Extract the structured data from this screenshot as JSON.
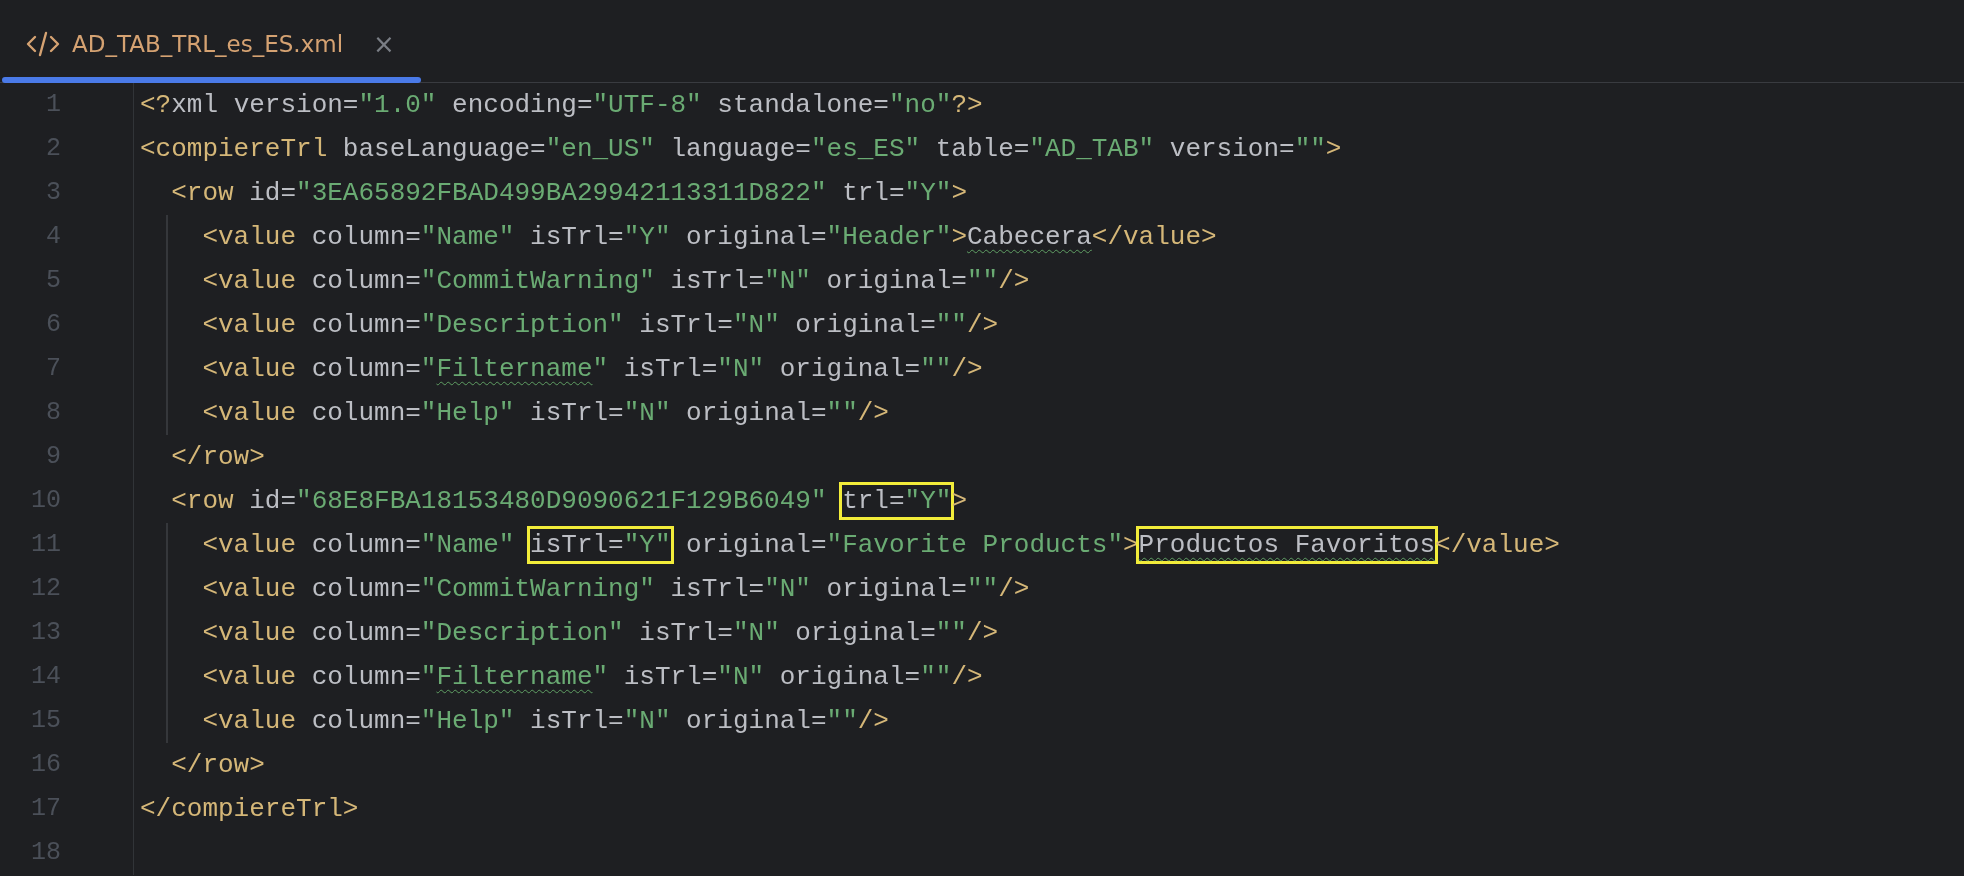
{
  "tabs": [
    {
      "label": "AD_TAB_TRL_es_ES.xml",
      "selected": true,
      "close": "×"
    }
  ],
  "editor": {
    "lines": [
      {
        "number": "1",
        "guide": false,
        "spans": [
          {
            "boxed": false,
            "tokens": [
              {
                "text": "<?",
                "kind": "tag",
                "wavy": false
              },
              {
                "text": "xml version=",
                "kind": "attr",
                "wavy": false
              },
              {
                "text": "\"1.0\"",
                "kind": "value",
                "wavy": false
              },
              {
                "text": " encoding=",
                "kind": "attr",
                "wavy": false
              },
              {
                "text": "\"UTF-8\"",
                "kind": "value",
                "wavy": false
              },
              {
                "text": " standalone=",
                "kind": "attr",
                "wavy": false
              },
              {
                "text": "\"no\"",
                "kind": "value",
                "wavy": false
              },
              {
                "text": "?>",
                "kind": "tag",
                "wavy": false
              }
            ]
          }
        ]
      },
      {
        "number": "2",
        "guide": false,
        "spans": [
          {
            "boxed": false,
            "tokens": [
              {
                "text": "<compiereTrl",
                "kind": "tag",
                "wavy": false
              },
              {
                "text": " baseLanguage=",
                "kind": "attr",
                "wavy": false
              },
              {
                "text": "\"en_US\"",
                "kind": "value",
                "wavy": false
              },
              {
                "text": " language=",
                "kind": "attr",
                "wavy": false
              },
              {
                "text": "\"es_ES\"",
                "kind": "value",
                "wavy": false
              },
              {
                "text": " table=",
                "kind": "attr",
                "wavy": false
              },
              {
                "text": "\"AD_TAB\"",
                "kind": "value",
                "wavy": false
              },
              {
                "text": " version=",
                "kind": "attr",
                "wavy": false
              },
              {
                "text": "\"\"",
                "kind": "value",
                "wavy": false
              },
              {
                "text": ">",
                "kind": "tag",
                "wavy": false
              }
            ]
          }
        ]
      },
      {
        "number": "3",
        "guide": false,
        "spans": [
          {
            "boxed": false,
            "tokens": [
              {
                "text": "  <row",
                "kind": "tag",
                "wavy": false
              },
              {
                "text": " id=",
                "kind": "attr",
                "wavy": false
              },
              {
                "text": "\"3EA65892FBAD499BA29942113311D822\"",
                "kind": "value",
                "wavy": false
              },
              {
                "text": " trl=",
                "kind": "attr",
                "wavy": false
              },
              {
                "text": "\"Y\"",
                "kind": "value",
                "wavy": false
              },
              {
                "text": ">",
                "kind": "tag",
                "wavy": false
              }
            ]
          }
        ]
      },
      {
        "number": "4",
        "guide": true,
        "spans": [
          {
            "boxed": false,
            "tokens": [
              {
                "text": "    <value",
                "kind": "tag",
                "wavy": false
              },
              {
                "text": " column=",
                "kind": "attr",
                "wavy": false
              },
              {
                "text": "\"Name\"",
                "kind": "value",
                "wavy": false
              },
              {
                "text": " isTrl=",
                "kind": "attr",
                "wavy": false
              },
              {
                "text": "\"Y\"",
                "kind": "value",
                "wavy": false
              },
              {
                "text": " original=",
                "kind": "attr",
                "wavy": false
              },
              {
                "text": "\"Header\"",
                "kind": "value",
                "wavy": false
              },
              {
                "text": ">",
                "kind": "tag",
                "wavy": false
              },
              {
                "text": "Cabecera",
                "kind": "text",
                "wavy": true
              },
              {
                "text": "</value>",
                "kind": "tag",
                "wavy": false
              }
            ]
          }
        ]
      },
      {
        "number": "5",
        "guide": true,
        "spans": [
          {
            "boxed": false,
            "tokens": [
              {
                "text": "    <value",
                "kind": "tag",
                "wavy": false
              },
              {
                "text": " column=",
                "kind": "attr",
                "wavy": false
              },
              {
                "text": "\"CommitWarning\"",
                "kind": "value",
                "wavy": false
              },
              {
                "text": " isTrl=",
                "kind": "attr",
                "wavy": false
              },
              {
                "text": "\"N\"",
                "kind": "value",
                "wavy": false
              },
              {
                "text": " original=",
                "kind": "attr",
                "wavy": false
              },
              {
                "text": "\"\"",
                "kind": "value",
                "wavy": false
              },
              {
                "text": "/>",
                "kind": "tag",
                "wavy": false
              }
            ]
          }
        ]
      },
      {
        "number": "6",
        "guide": true,
        "spans": [
          {
            "boxed": false,
            "tokens": [
              {
                "text": "    <value",
                "kind": "tag",
                "wavy": false
              },
              {
                "text": " column=",
                "kind": "attr",
                "wavy": false
              },
              {
                "text": "\"Description\"",
                "kind": "value",
                "wavy": false
              },
              {
                "text": " isTrl=",
                "kind": "attr",
                "wavy": false
              },
              {
                "text": "\"N\"",
                "kind": "value",
                "wavy": false
              },
              {
                "text": " original=",
                "kind": "attr",
                "wavy": false
              },
              {
                "text": "\"\"",
                "kind": "value",
                "wavy": false
              },
              {
                "text": "/>",
                "kind": "tag",
                "wavy": false
              }
            ]
          }
        ]
      },
      {
        "number": "7",
        "guide": true,
        "spans": [
          {
            "boxed": false,
            "tokens": [
              {
                "text": "    <value",
                "kind": "tag",
                "wavy": false
              },
              {
                "text": " column=",
                "kind": "attr",
                "wavy": false
              },
              {
                "text": "\"",
                "kind": "value",
                "wavy": false
              },
              {
                "text": "Filtername",
                "kind": "value",
                "wavy": true
              },
              {
                "text": "\"",
                "kind": "value",
                "wavy": false
              },
              {
                "text": " isTrl=",
                "kind": "attr",
                "wavy": false
              },
              {
                "text": "\"N\"",
                "kind": "value",
                "wavy": false
              },
              {
                "text": " original=",
                "kind": "attr",
                "wavy": false
              },
              {
                "text": "\"\"",
                "kind": "value",
                "wavy": false
              },
              {
                "text": "/>",
                "kind": "tag",
                "wavy": false
              }
            ]
          }
        ]
      },
      {
        "number": "8",
        "guide": true,
        "spans": [
          {
            "boxed": false,
            "tokens": [
              {
                "text": "    <value",
                "kind": "tag",
                "wavy": false
              },
              {
                "text": " column=",
                "kind": "attr",
                "wavy": false
              },
              {
                "text": "\"Help\"",
                "kind": "value",
                "wavy": false
              },
              {
                "text": " isTrl=",
                "kind": "attr",
                "wavy": false
              },
              {
                "text": "\"N\"",
                "kind": "value",
                "wavy": false
              },
              {
                "text": " original=",
                "kind": "attr",
                "wavy": false
              },
              {
                "text": "\"\"",
                "kind": "value",
                "wavy": false
              },
              {
                "text": "/>",
                "kind": "tag",
                "wavy": false
              }
            ]
          }
        ]
      },
      {
        "number": "9",
        "guide": false,
        "spans": [
          {
            "boxed": false,
            "tokens": [
              {
                "text": "  </row>",
                "kind": "tag",
                "wavy": false
              }
            ]
          }
        ]
      },
      {
        "number": "10",
        "guide": false,
        "spans": [
          {
            "boxed": false,
            "tokens": [
              {
                "text": "  <row",
                "kind": "tag",
                "wavy": false
              },
              {
                "text": " id=",
                "kind": "attr",
                "wavy": false
              },
              {
                "text": "\"68E8FBA18153480D9090621F129B6049\" ",
                "kind": "value",
                "wavy": false
              }
            ]
          },
          {
            "boxed": true,
            "tokens": [
              {
                "text": "trl=",
                "kind": "attr",
                "wavy": false
              },
              {
                "text": "\"Y\"",
                "kind": "value",
                "wavy": false
              }
            ]
          },
          {
            "boxed": false,
            "tokens": [
              {
                "text": ">",
                "kind": "tag",
                "wavy": false
              }
            ]
          }
        ]
      },
      {
        "number": "11",
        "guide": true,
        "spans": [
          {
            "boxed": false,
            "tokens": [
              {
                "text": "    <value",
                "kind": "tag",
                "wavy": false
              },
              {
                "text": " column=",
                "kind": "attr",
                "wavy": false
              },
              {
                "text": "\"Name\" ",
                "kind": "value",
                "wavy": false
              }
            ]
          },
          {
            "boxed": true,
            "tokens": [
              {
                "text": "isTrl=",
                "kind": "attr",
                "wavy": false
              },
              {
                "text": "\"Y\"",
                "kind": "value",
                "wavy": false
              }
            ]
          },
          {
            "boxed": false,
            "tokens": [
              {
                "text": " original=",
                "kind": "attr",
                "wavy": false
              },
              {
                "text": "\"Favorite Products\"",
                "kind": "value",
                "wavy": false
              },
              {
                "text": ">",
                "kind": "tag",
                "wavy": false
              }
            ]
          },
          {
            "boxed": true,
            "tokens": [
              {
                "text": "Productos Favoritos",
                "kind": "text",
                "wavy": true
              }
            ]
          },
          {
            "boxed": false,
            "tokens": [
              {
                "text": "</value>",
                "kind": "tag",
                "wavy": false
              }
            ]
          }
        ]
      },
      {
        "number": "12",
        "guide": true,
        "spans": [
          {
            "boxed": false,
            "tokens": [
              {
                "text": "    <value",
                "kind": "tag",
                "wavy": false
              },
              {
                "text": " column=",
                "kind": "attr",
                "wavy": false
              },
              {
                "text": "\"CommitWarning\"",
                "kind": "value",
                "wavy": false
              },
              {
                "text": " isTrl=",
                "kind": "attr",
                "wavy": false
              },
              {
                "text": "\"N\"",
                "kind": "value",
                "wavy": false
              },
              {
                "text": " original=",
                "kind": "attr",
                "wavy": false
              },
              {
                "text": "\"\"",
                "kind": "value",
                "wavy": false
              },
              {
                "text": "/>",
                "kind": "tag",
                "wavy": false
              }
            ]
          }
        ]
      },
      {
        "number": "13",
        "guide": true,
        "spans": [
          {
            "boxed": false,
            "tokens": [
              {
                "text": "    <value",
                "kind": "tag",
                "wavy": false
              },
              {
                "text": " column=",
                "kind": "attr",
                "wavy": false
              },
              {
                "text": "\"Description\"",
                "kind": "value",
                "wavy": false
              },
              {
                "text": " isTrl=",
                "kind": "attr",
                "wavy": false
              },
              {
                "text": "\"N\"",
                "kind": "value",
                "wavy": false
              },
              {
                "text": " original=",
                "kind": "attr",
                "wavy": false
              },
              {
                "text": "\"\"",
                "kind": "value",
                "wavy": false
              },
              {
                "text": "/>",
                "kind": "tag",
                "wavy": false
              }
            ]
          }
        ]
      },
      {
        "number": "14",
        "guide": true,
        "spans": [
          {
            "boxed": false,
            "tokens": [
              {
                "text": "    <value",
                "kind": "tag",
                "wavy": false
              },
              {
                "text": " column=",
                "kind": "attr",
                "wavy": false
              },
              {
                "text": "\"",
                "kind": "value",
                "wavy": false
              },
              {
                "text": "Filtername",
                "kind": "value",
                "wavy": true
              },
              {
                "text": "\"",
                "kind": "value",
                "wavy": false
              },
              {
                "text": " isTrl=",
                "kind": "attr",
                "wavy": false
              },
              {
                "text": "\"N\"",
                "kind": "value",
                "wavy": false
              },
              {
                "text": " original=",
                "kind": "attr",
                "wavy": false
              },
              {
                "text": "\"\"",
                "kind": "value",
                "wavy": false
              },
              {
                "text": "/>",
                "kind": "tag",
                "wavy": false
              }
            ]
          }
        ]
      },
      {
        "number": "15",
        "guide": true,
        "spans": [
          {
            "boxed": false,
            "tokens": [
              {
                "text": "    <value",
                "kind": "tag",
                "wavy": false
              },
              {
                "text": " column=",
                "kind": "attr",
                "wavy": false
              },
              {
                "text": "\"Help\"",
                "kind": "value",
                "wavy": false
              },
              {
                "text": " isTrl=",
                "kind": "attr",
                "wavy": false
              },
              {
                "text": "\"N\"",
                "kind": "value",
                "wavy": false
              },
              {
                "text": " original=",
                "kind": "attr",
                "wavy": false
              },
              {
                "text": "\"\"",
                "kind": "value",
                "wavy": false
              },
              {
                "text": "/>",
                "kind": "tag",
                "wavy": false
              }
            ]
          }
        ]
      },
      {
        "number": "16",
        "guide": false,
        "spans": [
          {
            "boxed": false,
            "tokens": [
              {
                "text": "  </row>",
                "kind": "tag",
                "wavy": false
              }
            ]
          }
        ]
      },
      {
        "number": "17",
        "guide": false,
        "spans": [
          {
            "boxed": false,
            "tokens": [
              {
                "text": "</compiereTrl>",
                "kind": "tag",
                "wavy": false
              }
            ]
          }
        ]
      },
      {
        "number": "18",
        "guide": false
      }
    ]
  }
}
